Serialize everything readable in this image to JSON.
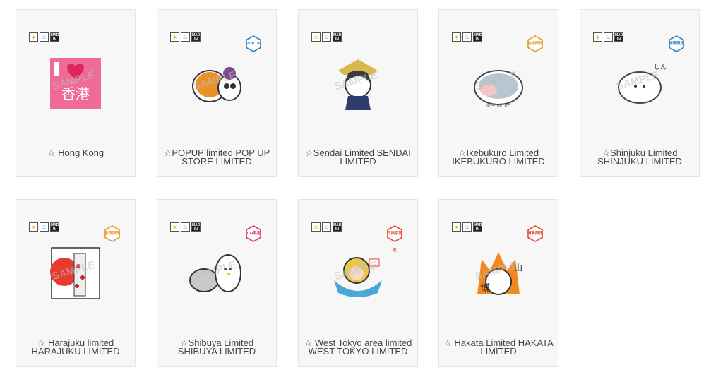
{
  "badges": {
    "one": "☀",
    "two": "♨",
    "three": "MADE IN JAPAN"
  },
  "watermark": "SAMPLE",
  "products": [
    {
      "title_line1": "☆ Hong Kong",
      "title_line2": "",
      "tag": "",
      "tag_color": "#2a8a5a",
      "art_color": "#f06a96"
    },
    {
      "title_line1": "☆POPUP limited POP UP",
      "title_line2": "STORE LIMITED",
      "tag": "POP UP",
      "tag_color": "#2a86c8",
      "art_color": "#e9902a"
    },
    {
      "title_line1": "☆Sendai Limited SENDAI",
      "title_line2": "LIMITED",
      "tag": "",
      "tag_color": "#2a8a5a",
      "art_color": "#d8b84a"
    },
    {
      "title_line1": "☆Ikebukuro Limited",
      "title_line2": "IKEBUKURO LIMITED",
      "tag": "池袋限定",
      "tag_color": "#e69a25",
      "art_color": "#b8c6cf"
    },
    {
      "title_line1": "☆Shinjuku Limited",
      "title_line2": "SHINJUKU LIMITED",
      "tag": "新宿限定",
      "tag_color": "#2a86c8",
      "art_color": "#f2f2f2"
    },
    {
      "title_line1": "☆ Harajuku limited",
      "title_line2": "HARAJUKU LIMITED",
      "tag": "原宿限定",
      "tag_color": "#e69a25",
      "art_color": "#e63b2e"
    },
    {
      "title_line1": "☆Shibuya Limited",
      "title_line2": "SHIBUYA LIMITED",
      "tag": "109限定",
      "tag_color": "#d23a7d",
      "art_color": "#c9c9c9"
    },
    {
      "title_line1": "☆ West Tokyo area limited",
      "title_line2": "WEST TOKYO LIMITED",
      "tag": "西東京限定",
      "tag_color": "#e2472d",
      "art_color": "#e7c54e"
    },
    {
      "title_line1": "☆ Hakata Limited HAKATA",
      "title_line2": "LIMITED",
      "tag": "博多限定",
      "tag_color": "#e2472d",
      "art_color": "#f08a20"
    }
  ]
}
